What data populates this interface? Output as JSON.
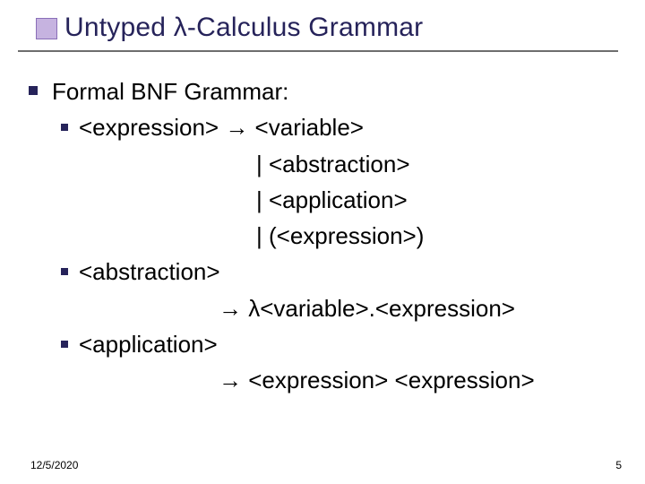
{
  "title_prefix": "Untyped ",
  "lambda": "λ",
  "title_suffix": "-Calculus Grammar",
  "arrow": "→",
  "heading": "Formal BNF Grammar:",
  "rule1_l1": "<expression> → <variable>",
  "rule1_l2": "| <abstraction>",
  "rule1_l3": "| <application>",
  "rule1_l4": "| (<expression>)",
  "rule2_l1": "<abstraction>",
  "rule2_l2": "→ λ<variable>.<expression>",
  "rule3_l1": "<application>",
  "rule3_l2": "→ <expression> <expression>",
  "footer_date": "12/5/2020",
  "footer_page": "5"
}
